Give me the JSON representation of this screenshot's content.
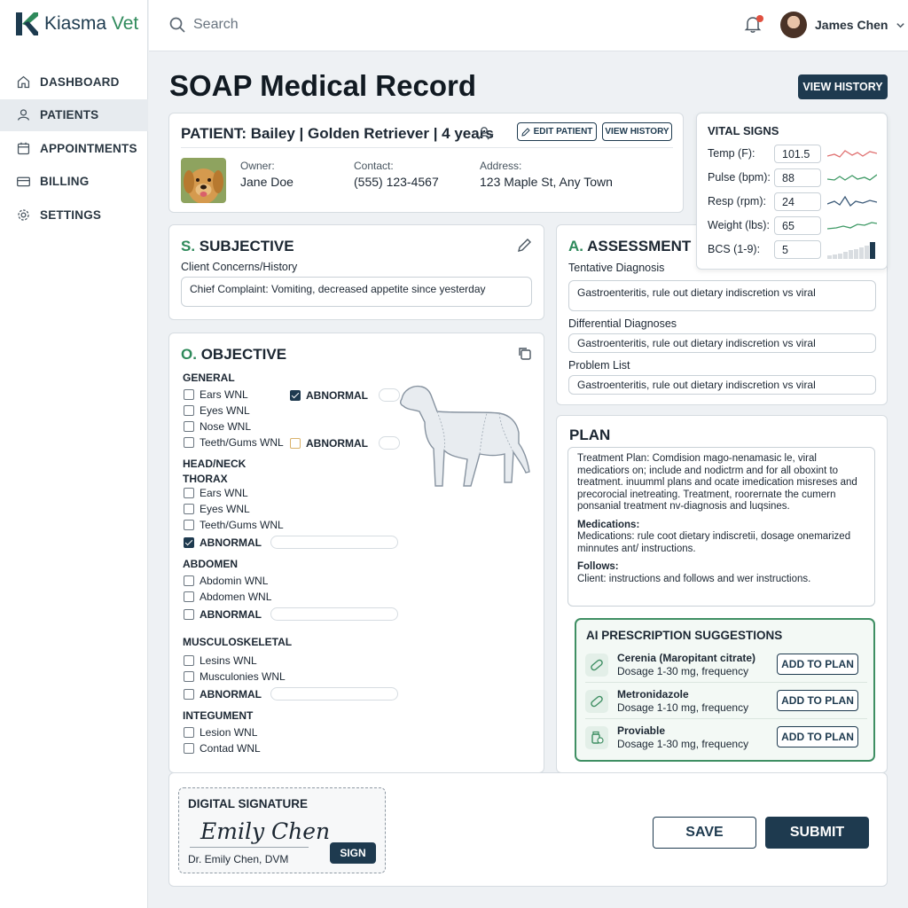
{
  "app": {
    "name_primary": "Kiasma",
    "name_accent": "Vet"
  },
  "sidebar": {
    "items": [
      {
        "label": "DASHBOARD",
        "icon": "home-icon"
      },
      {
        "label": "PATIENTS",
        "icon": "user-icon"
      },
      {
        "label": "APPOINTMENTS",
        "icon": "calendar-icon"
      },
      {
        "label": "BILLING",
        "icon": "card-icon"
      },
      {
        "label": "SETTINGS",
        "icon": "gear-icon"
      }
    ]
  },
  "topbar": {
    "search_placeholder": "Search",
    "user_name": "James Chen"
  },
  "page": {
    "title": "SOAP Medical Record",
    "view_history": "VIEW HISTORY"
  },
  "patient": {
    "header": "PATIENT: Bailey | Golden Retriever | 4 years",
    "edit_label": "EDIT PATIENT",
    "history_label": "VIEW HISTORY",
    "owner_label": "Owner:",
    "owner": "Jane Doe",
    "contact_label": "Contact:",
    "contact": "(555) 123-4567",
    "address_label": "Address:",
    "address": "123 Maple St, Any Town"
  },
  "vitals": {
    "title": "VITAL SIGNS",
    "rows": [
      {
        "label": "Temp (F):",
        "value": "101.5"
      },
      {
        "label": "Pulse (bpm):",
        "value": "88"
      },
      {
        "label": "Resp (rpm):",
        "value": "24"
      },
      {
        "label": "Weight (lbs):",
        "value": "65"
      },
      {
        "label": "BCS (1-9):",
        "value": "5"
      }
    ]
  },
  "subjective": {
    "letter": "S.",
    "title": "SUBJECTIVE",
    "field_label": "Client Concerns/History",
    "field_value": "Chief Complaint: Vomiting, decreased appetite since yesterday"
  },
  "assessment": {
    "letter": "A.",
    "title": "ASSESSMENT",
    "tentative_label": "Tentative Diagnosis",
    "tentative_value": "Gastroenteritis, rule out dietary indiscretion vs viral",
    "differential_label": "Differential Diagnoses",
    "differential_value": "Gastroenteritis, rule out dietary indiscretion vs viral",
    "problem_label": "Problem List",
    "problem_value": "Gastroenteritis, rule out dietary indiscretion vs viral"
  },
  "objective": {
    "letter": "O.",
    "title": "OBJECTIVE",
    "general": {
      "title": "GENERAL",
      "items": [
        "Ears WNL",
        "Eyes WNL",
        "Nose WNL",
        "Teeth/Gums WNL"
      ],
      "abnormal": "ABNORMAL"
    },
    "head": {
      "title": "HEAD/NECK",
      "subtitle": "THORAX",
      "items": [
        "Ears WNL",
        "Eyes WNL",
        "Teeth/Gums WNL"
      ],
      "abnormal": "ABNORMAL"
    },
    "abdomen": {
      "title": "ABDOMEN",
      "items": [
        "Abdomin WNL",
        "Abdomen WNL"
      ],
      "abnormal": "ABNORMAL"
    },
    "musculo": {
      "title": "MUSCULOSKELETAL",
      "items": [
        "Lesins WNL",
        "Musculonies WNL"
      ],
      "abnormal": "ABNORMAL"
    },
    "integument": {
      "title": "INTEGUMENT",
      "items": [
        "Lesion WNL",
        "Contad WNL"
      ]
    }
  },
  "plan": {
    "title": "PLAN",
    "treatment": "Treatment Plan: Comdision mago-nenamasic le, viral medicatiors on; include and nodictrm and for all oboxint to treatment. inuumml plans and ocate imedication misreses and precorocial inetreating. Treatment, roorernate the cumern ponsanial treatment nv-diagnosis and luqsines.",
    "medications_label": "Medications:",
    "medications": "Medications: rule coot dietary indiscretii, dosage onemarized minnutes ant/ instructions.",
    "follows_label": "Follows:",
    "follows": "Client: instructions and follows and wer instructions."
  },
  "ai": {
    "title": "AI PRESCRIPTION SUGGESTIONS",
    "add_label": "ADD TO PLAN",
    "items": [
      {
        "name": "Cerenia (Maropitant citrate)",
        "dosage": "Dosage 1-30 mg, frequency"
      },
      {
        "name": "Metronidazole",
        "dosage": "Dosage 1-10 mg, frequency"
      },
      {
        "name": "Proviable",
        "dosage": "Dosage 1-30 mg, frequency"
      }
    ]
  },
  "signature": {
    "title": "DIGITAL SIGNATURE",
    "script": "Emily Chen",
    "name": "Dr. Emily Chen, DVM",
    "sign_label": "SIGN"
  },
  "actions": {
    "save": "SAVE",
    "submit": "SUBMIT"
  },
  "colors": {
    "accent": "#2f8a5b",
    "primary": "#1e3a4f",
    "alert": "#e0503f"
  }
}
